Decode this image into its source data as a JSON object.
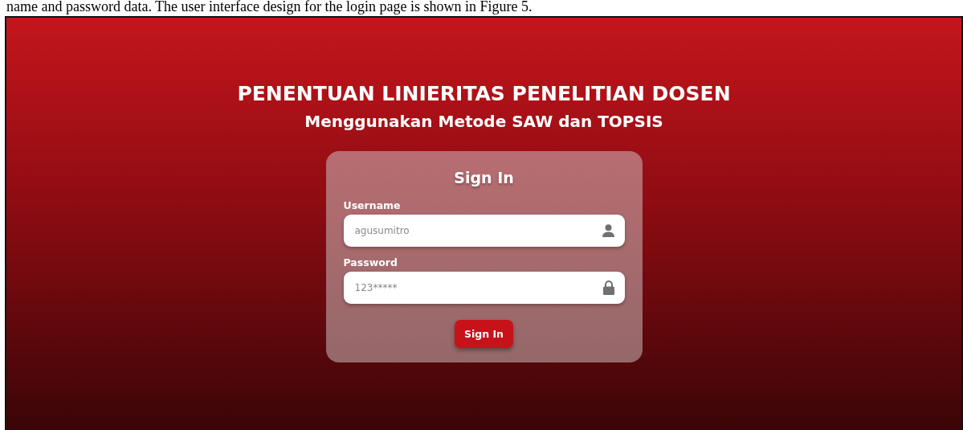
{
  "caption": "name and password data. The user interface design for the login page is shown in Figure 5.",
  "header": {
    "title": "PENENTUAN LINIERITAS PENELITIAN DOSEN",
    "subtitle": "Menggunakan Metode SAW dan TOPSIS"
  },
  "login_card": {
    "heading": "Sign In",
    "fields": [
      {
        "label": "Username",
        "placeholder": "agusumitro",
        "kind": "user"
      },
      {
        "label": "Password",
        "placeholder": "123*****",
        "kind": "lock"
      }
    ],
    "button": "Sign In"
  }
}
